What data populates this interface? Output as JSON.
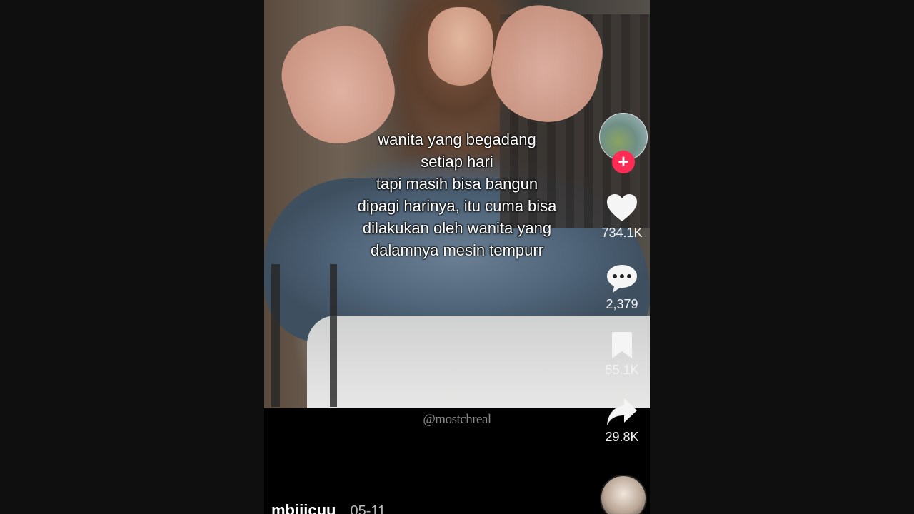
{
  "video": {
    "caption_lines": [
      "wanita yang begadang",
      "setiap hari",
      "tapi masih bisa bangun",
      "dipagi harinya, itu cuma bisa",
      "dilakukan oleh wanita yang",
      "dalamnya mesin tempurr"
    ],
    "watermark": "@mostchreal"
  },
  "actions": {
    "likes": "734.1K",
    "comments": "2,379",
    "saves": "55.1K",
    "shares": "29.8K",
    "follow_symbol": "+"
  },
  "author": {
    "username": "mbiiicuu",
    "date": "05-11"
  },
  "colors": {
    "accent": "#fe2c55",
    "background": "#0f0f0f"
  },
  "icons": [
    "heart-icon",
    "comment-icon",
    "bookmark-icon",
    "share-icon",
    "plus-icon"
  ]
}
